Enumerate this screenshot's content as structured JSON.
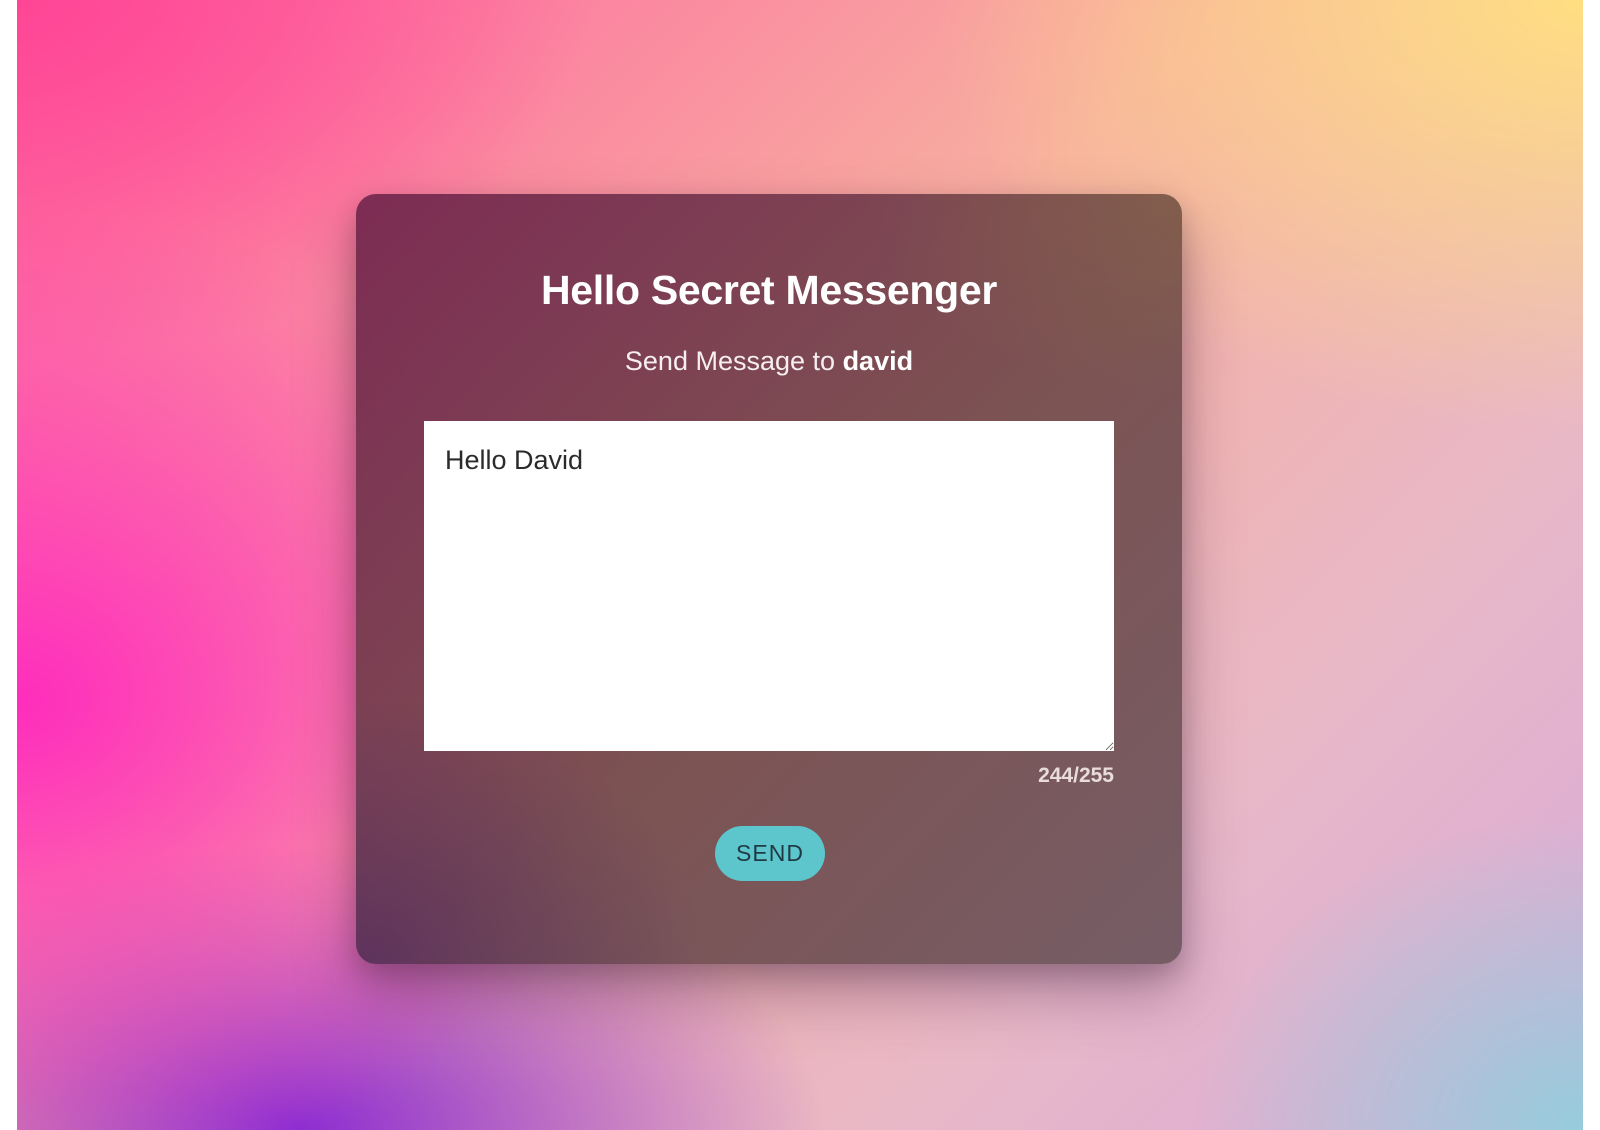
{
  "page": {
    "title": "Hello Secret Messenger",
    "subtitle_prefix": "Send Message to",
    "recipient": "david"
  },
  "message": {
    "value": "Hello David",
    "counter": "244/255"
  },
  "actions": {
    "send_label": "SEND"
  },
  "colors": {
    "send_button": "#5cc6cc",
    "card_base": "#784050",
    "textarea_bg": "#ffffff"
  }
}
